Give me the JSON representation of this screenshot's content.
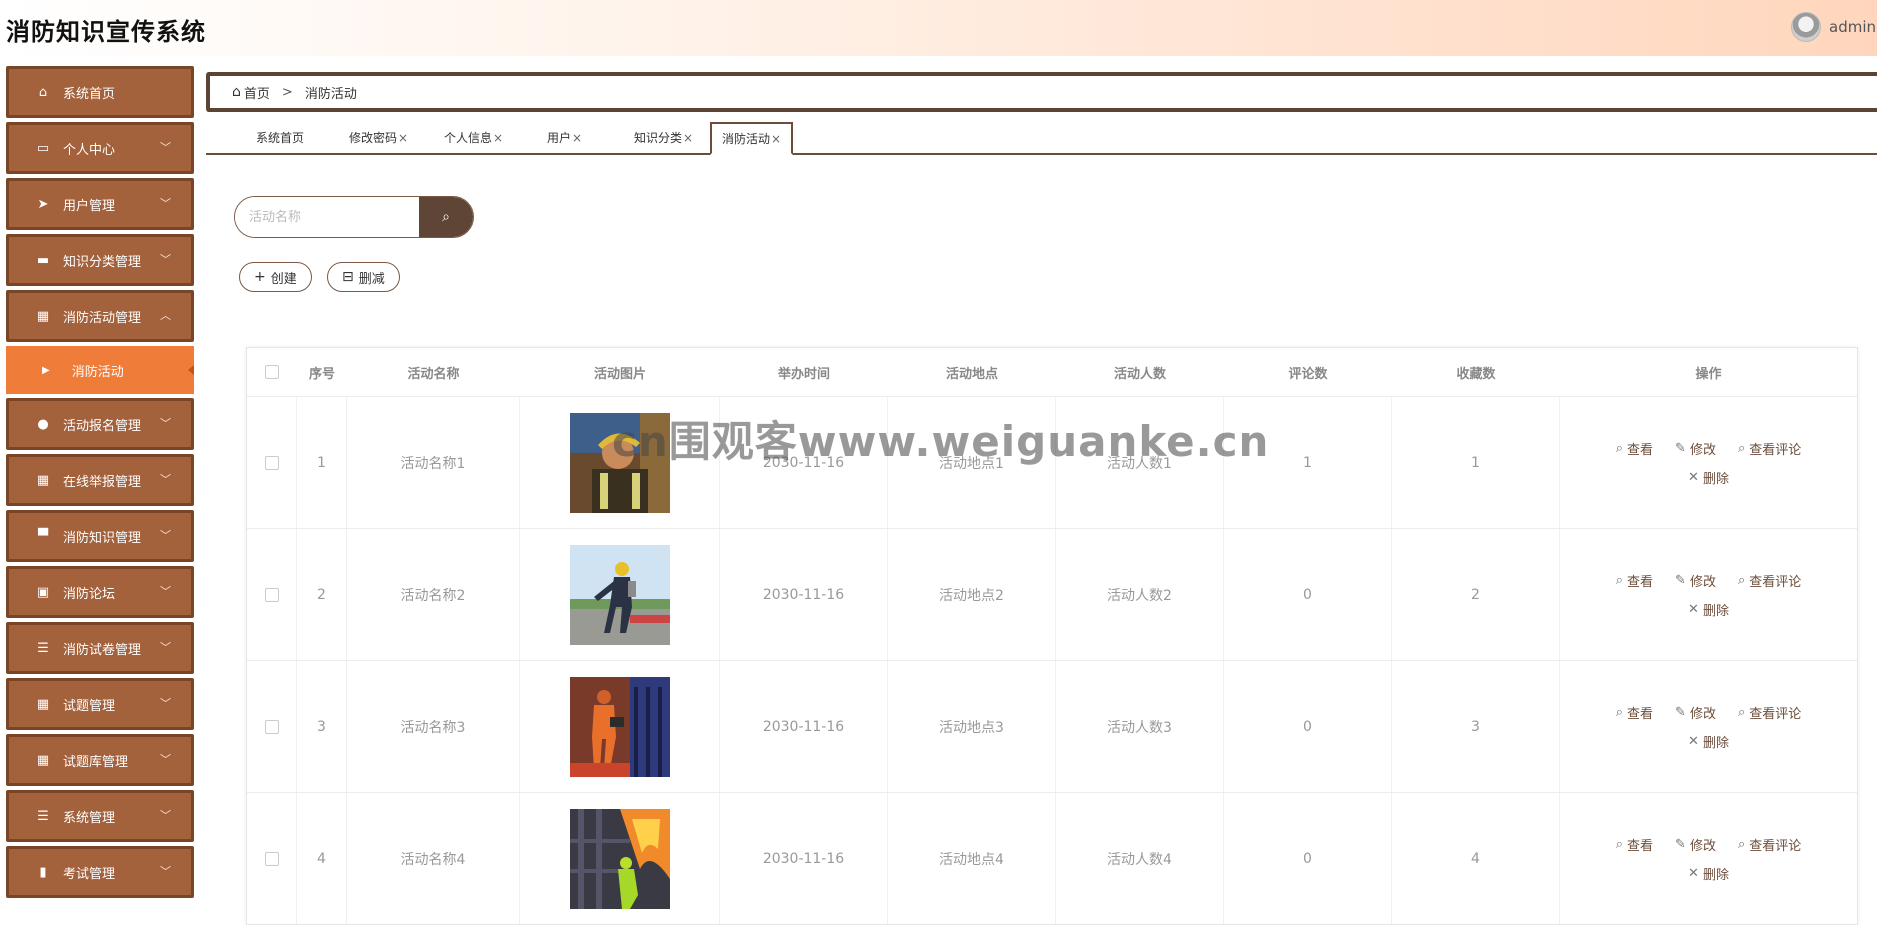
{
  "app": {
    "title": "消防知识宣传系统",
    "user": "admin"
  },
  "sidebar": {
    "items": [
      {
        "label": "系统首页",
        "icon": "home-icon"
      },
      {
        "label": "个人中心",
        "icon": "wallet-icon"
      },
      {
        "label": "用户管理",
        "icon": "send-icon"
      },
      {
        "label": "知识分类管理",
        "icon": "ticket-icon"
      },
      {
        "label": "消防活动管理",
        "icon": "grid-icon"
      },
      {
        "label": "活动报名管理",
        "icon": "bulb-icon"
      },
      {
        "label": "在线举报管理",
        "icon": "grid-icon"
      },
      {
        "label": "消防知识管理",
        "icon": "monitor-icon"
      },
      {
        "label": "消防论坛",
        "icon": "clipboard-icon"
      },
      {
        "label": "消防试卷管理",
        "icon": "list-icon"
      },
      {
        "label": "试题管理",
        "icon": "grid-icon"
      },
      {
        "label": "试题库管理",
        "icon": "grid-icon"
      },
      {
        "label": "系统管理",
        "icon": "list-icon"
      },
      {
        "label": "考试管理",
        "icon": "bar-chart-icon"
      }
    ],
    "sub_item": {
      "label": "消防活动"
    }
  },
  "breadcrumb": {
    "home": "首页",
    "current": "消防活动"
  },
  "tabs": [
    {
      "label": "系统首页"
    },
    {
      "label": "修改密码"
    },
    {
      "label": "个人信息"
    },
    {
      "label": "用户"
    },
    {
      "label": "知识分类"
    },
    {
      "label": "消防活动"
    }
  ],
  "search": {
    "placeholder": "活动名称"
  },
  "actions": {
    "create": "创建",
    "delete": "删减"
  },
  "table": {
    "headers": [
      "序号",
      "活动名称",
      "活动图片",
      "举办时间",
      "活动地点",
      "活动人数",
      "评论数",
      "收藏数",
      "操作"
    ],
    "rows": [
      {
        "index": "1",
        "name": "活动名称1",
        "time": "2030-11-16",
        "place": "活动地点1",
        "people": "活动人数1",
        "comments": "1",
        "favorites": "1"
      },
      {
        "index": "2",
        "name": "活动名称2",
        "time": "2030-11-16",
        "place": "活动地点2",
        "people": "活动人数2",
        "comments": "0",
        "favorites": "2"
      },
      {
        "index": "3",
        "name": "活动名称3",
        "time": "2030-11-16",
        "place": "活动地点3",
        "people": "活动人数3",
        "comments": "0",
        "favorites": "3"
      },
      {
        "index": "4",
        "name": "活动名称4",
        "time": "2030-11-16",
        "place": "活动地点4",
        "people": "活动人数4",
        "comments": "0",
        "favorites": "4"
      }
    ],
    "ops": {
      "view": "查看",
      "edit": "修改",
      "view_comments": "查看评论",
      "remove": "删除"
    }
  },
  "watermark": "cn围观客www.weiguanke.cn",
  "colors": {
    "sidebar": "#a3613c",
    "sidebar_active": "#f07c3a",
    "accent_dark": "#5f4535"
  }
}
